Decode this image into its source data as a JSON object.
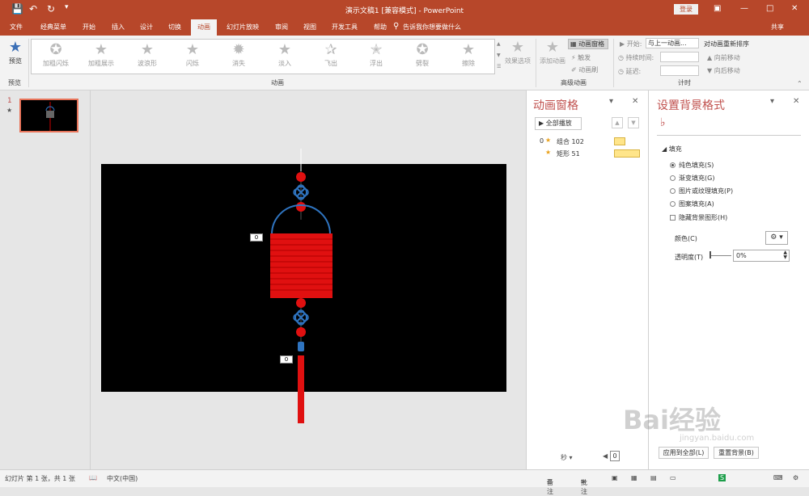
{
  "titlebar": {
    "title": "演示文稿1 [兼容模式] - PowerPoint",
    "login": "登录",
    "qa_icons": [
      "save-icon",
      "undo-icon",
      "redo-icon",
      "customize-icon"
    ]
  },
  "tabs": [
    "文件",
    "经典菜单",
    "开始",
    "插入",
    "设计",
    "切换",
    "动画",
    "幻灯片放映",
    "审阅",
    "视图",
    "开发工具",
    "帮助"
  ],
  "active_tab": "动画",
  "tellme": "告诉我你想要做什么",
  "share": "共享",
  "ribbon": {
    "preview_label": "预览",
    "preview_group": "预览",
    "effects": [
      "加粗闪烁",
      "加粗展示",
      "波浪形",
      "闪烁",
      "消失",
      "淡入",
      "飞出",
      "浮出",
      "劈裂",
      "擦除"
    ],
    "effect_options": "效果选项",
    "animation_group": "动画",
    "add_animation": "添加动画",
    "animation_pane_btn": "动画窗格",
    "trigger": "触发",
    "anim_painter": "动画刷",
    "advanced_group": "高级动画",
    "start_label": "开始:",
    "start_value": "与上一动画...",
    "duration_label": "持续时间:",
    "delay_label": "延迟:",
    "timing_group": "计时",
    "reorder_title": "对动画重新排序",
    "move_earlier": "向前移动",
    "move_later": "向后移动"
  },
  "slide_number": "1",
  "slide_star": "★",
  "slide_tags": [
    "0",
    "0"
  ],
  "animpane": {
    "title": "动画窗格",
    "play_all": "全部播放",
    "items": [
      {
        "index": "0",
        "name": "组合 102"
      },
      {
        "index": "",
        "name": "矩形 51"
      }
    ],
    "seconds_label": "秒",
    "timeline_value": "0"
  },
  "fmtpane": {
    "title": "设置背景格式",
    "section": "填充",
    "options": [
      "纯色填充(S)",
      "渐变填充(G)",
      "图片或纹理填充(P)",
      "图案填充(A)"
    ],
    "selected_option": "纯色填充(S)",
    "hide_bg": "隐藏背景图形(H)",
    "color_label": "颜色(C)",
    "transparency_label": "透明度(T)",
    "transparency_value": "0%",
    "apply_all": "应用到全部(L)",
    "reset_bg": "重置背景(B)"
  },
  "statusbar": {
    "slide_info": "幻灯片 第 1 张，共 1 张",
    "language": "中文(中国)",
    "notes": "备注",
    "comments": "批注"
  },
  "watermark": {
    "main": "Bai经验",
    "sub": "jingyan.baidu.com"
  },
  "colors": {
    "brand": "#b7472a",
    "lantern_red": "#e01010",
    "knot_blue": "#2f74c0",
    "pane_title": "#c0504d"
  }
}
